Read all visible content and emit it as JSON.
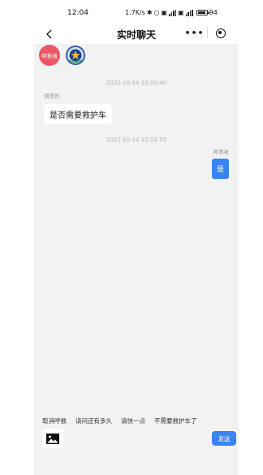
{
  "status_bar": {
    "time": "12:04",
    "speed": "1.7K/s",
    "battery": "94"
  },
  "nav": {
    "title": "实时聊天"
  },
  "participants": {
    "caller_label": "呼救者"
  },
  "messages": [
    {
      "timestamp": "2022-10-14 12:02:40",
      "sender": "调度员",
      "text": "是否需要救护车",
      "side": "left"
    },
    {
      "timestamp": "2022-10-14 12:02:55",
      "sender": "呼救者",
      "text": "是",
      "side": "right"
    }
  ],
  "quick_replies": [
    "取消呼救",
    "请问还有多久",
    "请快一点",
    "不需要救护车了"
  ],
  "input": {
    "send_label": "发送"
  },
  "colors": {
    "accent": "#3a83f4",
    "caller_badge": "#ec5665",
    "background": "#f2f2f2"
  }
}
